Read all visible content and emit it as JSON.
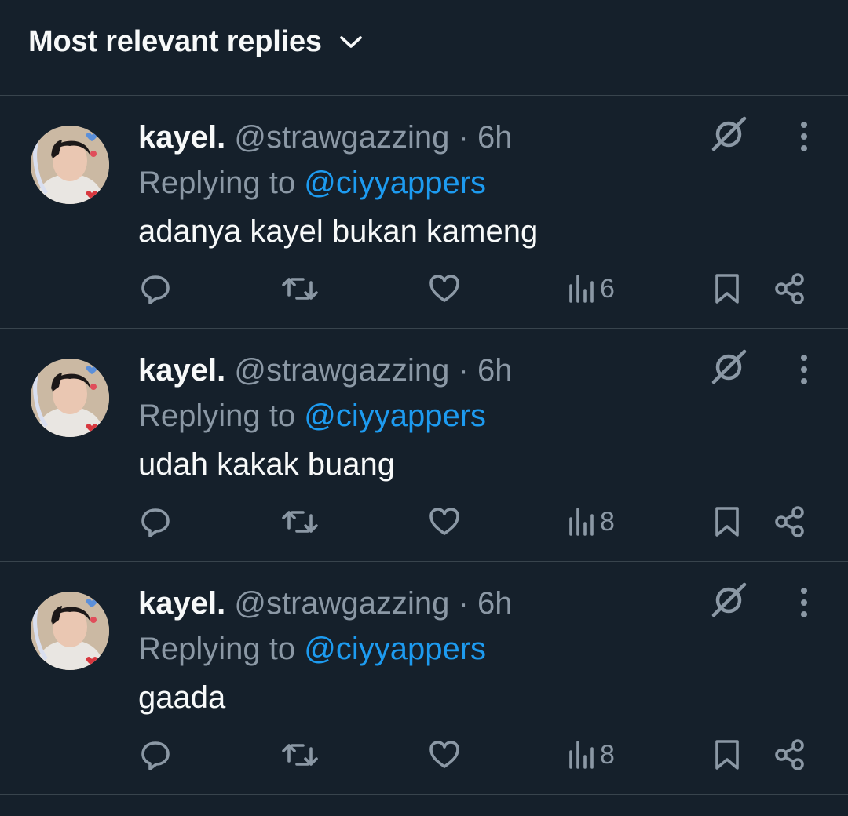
{
  "header": {
    "sort_label": "Most relevant replies"
  },
  "replies": [
    {
      "display_name": "kayel.",
      "handle": "@strawgazzing",
      "separator": "·",
      "time": "6h",
      "replying_prefix": "Replying to",
      "replying_to": "@ciyyappers",
      "text": "adanya kayel bukan kameng",
      "views": "6"
    },
    {
      "display_name": "kayel.",
      "handle": "@strawgazzing",
      "separator": "·",
      "time": "6h",
      "replying_prefix": "Replying to",
      "replying_to": "@ciyyappers",
      "text": "udah kakak buang",
      "views": "8"
    },
    {
      "display_name": "kayel.",
      "handle": "@strawgazzing",
      "separator": "·",
      "time": "6h",
      "replying_prefix": "Replying to",
      "replying_to": "@ciyyappers",
      "text": "gaada",
      "views": "8"
    }
  ],
  "icons": {
    "chevron": "chevron-down-icon",
    "grok": "grok-icon",
    "more": "more-vertical-icon",
    "reply": "reply-icon",
    "retweet": "retweet-icon",
    "like": "heart-icon",
    "views": "views-icon",
    "bookmark": "bookmark-icon",
    "share": "share-icon"
  },
  "colors": {
    "background": "#15202b",
    "divider": "#38444d",
    "primary_text": "#f7f9f9",
    "secondary_text": "#8b98a5",
    "link": "#1d9bf0"
  }
}
